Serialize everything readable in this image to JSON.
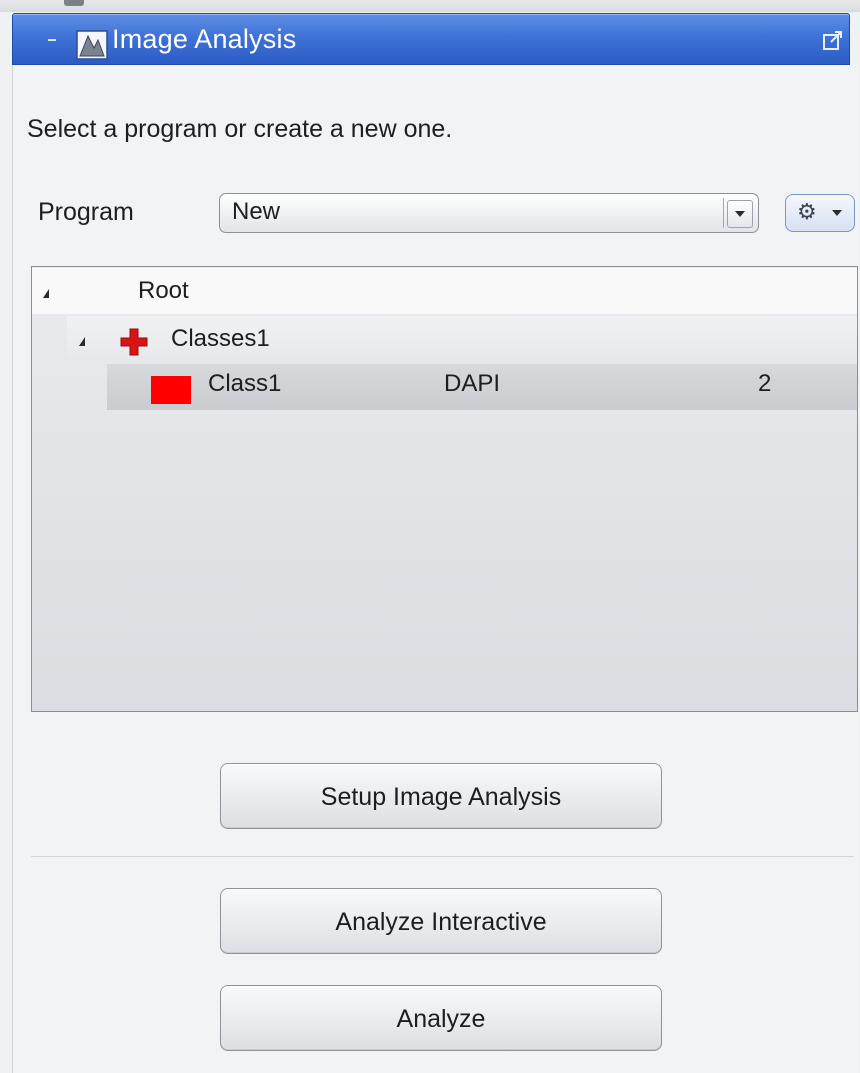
{
  "panel": {
    "title": "Image Analysis",
    "icons": {
      "collapse": "collapse-icon",
      "app": "image-analysis-icon",
      "popout": "popout-icon"
    }
  },
  "instruction": "Select a program or create a new one.",
  "program": {
    "label": "Program",
    "selected": "New",
    "settings_icon": "gear-icon"
  },
  "tree": {
    "root": {
      "label": "Root"
    },
    "group": {
      "label": "Classes1",
      "icon": "red-cross-icon"
    },
    "class": {
      "label": "Class1",
      "channel": "DAPI",
      "value": "2",
      "color": "#ff0000"
    }
  },
  "buttons": {
    "setup": "Setup Image Analysis",
    "interactive": "Analyze Interactive",
    "analyze": "Analyze"
  },
  "colors": {
    "header": "#3f72d6",
    "swatch": "#ff0000"
  }
}
